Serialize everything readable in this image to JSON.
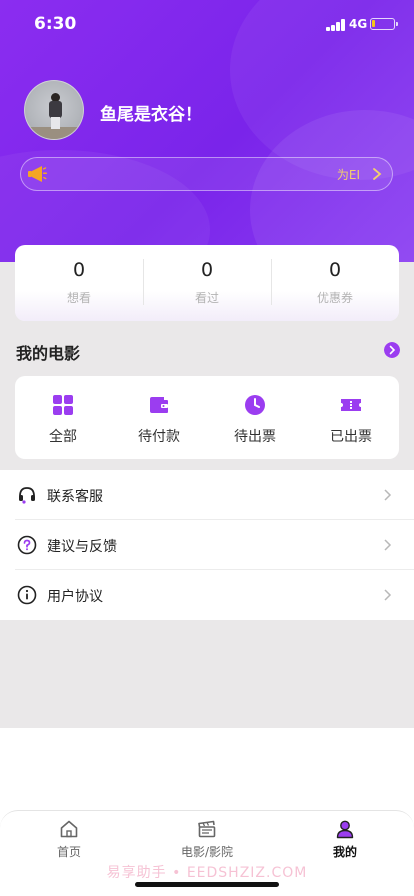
{
  "status": {
    "time": "6:30",
    "network": "4G"
  },
  "profile": {
    "username": "鱼尾是衣谷！"
  },
  "notice": {
    "text": "为EI"
  },
  "stats": [
    {
      "value": "0",
      "label": "想看"
    },
    {
      "value": "0",
      "label": "看过"
    },
    {
      "value": "0",
      "label": "优惠券"
    }
  ],
  "my_movies": {
    "title": "我的电影",
    "items": [
      {
        "label": "全部",
        "icon": "grid-icon"
      },
      {
        "label": "待付款",
        "icon": "wallet-icon"
      },
      {
        "label": "待出票",
        "icon": "clock-icon"
      },
      {
        "label": "已出票",
        "icon": "ticket-icon"
      }
    ]
  },
  "menu": [
    {
      "label": "联系客服",
      "icon": "headset-icon"
    },
    {
      "label": "建议与反馈",
      "icon": "question-icon"
    },
    {
      "label": "用户协议",
      "icon": "info-icon"
    }
  ],
  "tabs": [
    {
      "label": "首页",
      "icon": "home-icon"
    },
    {
      "label": "电影/影院",
      "icon": "clapperboard-icon"
    },
    {
      "label": "我的",
      "icon": "user-icon",
      "active": true
    }
  ],
  "watermark": "易享助手 • EEDSHZIZ.COM",
  "colors": {
    "primary": "#8b2df0",
    "notice_text": "#f2cf6d",
    "megaphone": "#f5a623"
  }
}
